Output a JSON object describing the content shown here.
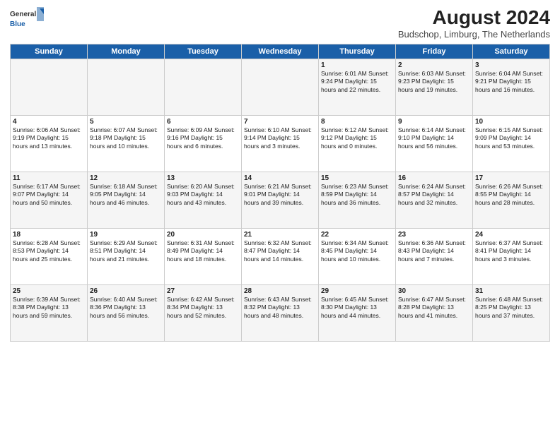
{
  "header": {
    "logo_general": "General",
    "logo_blue": "Blue",
    "main_title": "August 2024",
    "subtitle": "Budschop, Limburg, The Netherlands"
  },
  "days_of_week": [
    "Sunday",
    "Monday",
    "Tuesday",
    "Wednesday",
    "Thursday",
    "Friday",
    "Saturday"
  ],
  "weeks": [
    [
      {
        "day": "",
        "content": ""
      },
      {
        "day": "",
        "content": ""
      },
      {
        "day": "",
        "content": ""
      },
      {
        "day": "",
        "content": ""
      },
      {
        "day": "1",
        "content": "Sunrise: 6:01 AM\nSunset: 9:24 PM\nDaylight: 15 hours and 22 minutes."
      },
      {
        "day": "2",
        "content": "Sunrise: 6:03 AM\nSunset: 9:23 PM\nDaylight: 15 hours and 19 minutes."
      },
      {
        "day": "3",
        "content": "Sunrise: 6:04 AM\nSunset: 9:21 PM\nDaylight: 15 hours and 16 minutes."
      }
    ],
    [
      {
        "day": "4",
        "content": "Sunrise: 6:06 AM\nSunset: 9:19 PM\nDaylight: 15 hours and 13 minutes."
      },
      {
        "day": "5",
        "content": "Sunrise: 6:07 AM\nSunset: 9:18 PM\nDaylight: 15 hours and 10 minutes."
      },
      {
        "day": "6",
        "content": "Sunrise: 6:09 AM\nSunset: 9:16 PM\nDaylight: 15 hours and 6 minutes."
      },
      {
        "day": "7",
        "content": "Sunrise: 6:10 AM\nSunset: 9:14 PM\nDaylight: 15 hours and 3 minutes."
      },
      {
        "day": "8",
        "content": "Sunrise: 6:12 AM\nSunset: 9:12 PM\nDaylight: 15 hours and 0 minutes."
      },
      {
        "day": "9",
        "content": "Sunrise: 6:14 AM\nSunset: 9:10 PM\nDaylight: 14 hours and 56 minutes."
      },
      {
        "day": "10",
        "content": "Sunrise: 6:15 AM\nSunset: 9:09 PM\nDaylight: 14 hours and 53 minutes."
      }
    ],
    [
      {
        "day": "11",
        "content": "Sunrise: 6:17 AM\nSunset: 9:07 PM\nDaylight: 14 hours and 50 minutes."
      },
      {
        "day": "12",
        "content": "Sunrise: 6:18 AM\nSunset: 9:05 PM\nDaylight: 14 hours and 46 minutes."
      },
      {
        "day": "13",
        "content": "Sunrise: 6:20 AM\nSunset: 9:03 PM\nDaylight: 14 hours and 43 minutes."
      },
      {
        "day": "14",
        "content": "Sunrise: 6:21 AM\nSunset: 9:01 PM\nDaylight: 14 hours and 39 minutes."
      },
      {
        "day": "15",
        "content": "Sunrise: 6:23 AM\nSunset: 8:59 PM\nDaylight: 14 hours and 36 minutes."
      },
      {
        "day": "16",
        "content": "Sunrise: 6:24 AM\nSunset: 8:57 PM\nDaylight: 14 hours and 32 minutes."
      },
      {
        "day": "17",
        "content": "Sunrise: 6:26 AM\nSunset: 8:55 PM\nDaylight: 14 hours and 28 minutes."
      }
    ],
    [
      {
        "day": "18",
        "content": "Sunrise: 6:28 AM\nSunset: 8:53 PM\nDaylight: 14 hours and 25 minutes."
      },
      {
        "day": "19",
        "content": "Sunrise: 6:29 AM\nSunset: 8:51 PM\nDaylight: 14 hours and 21 minutes."
      },
      {
        "day": "20",
        "content": "Sunrise: 6:31 AM\nSunset: 8:49 PM\nDaylight: 14 hours and 18 minutes."
      },
      {
        "day": "21",
        "content": "Sunrise: 6:32 AM\nSunset: 8:47 PM\nDaylight: 14 hours and 14 minutes."
      },
      {
        "day": "22",
        "content": "Sunrise: 6:34 AM\nSunset: 8:45 PM\nDaylight: 14 hours and 10 minutes."
      },
      {
        "day": "23",
        "content": "Sunrise: 6:36 AM\nSunset: 8:43 PM\nDaylight: 14 hours and 7 minutes."
      },
      {
        "day": "24",
        "content": "Sunrise: 6:37 AM\nSunset: 8:41 PM\nDaylight: 14 hours and 3 minutes."
      }
    ],
    [
      {
        "day": "25",
        "content": "Sunrise: 6:39 AM\nSunset: 8:38 PM\nDaylight: 13 hours and 59 minutes."
      },
      {
        "day": "26",
        "content": "Sunrise: 6:40 AM\nSunset: 8:36 PM\nDaylight: 13 hours and 56 minutes."
      },
      {
        "day": "27",
        "content": "Sunrise: 6:42 AM\nSunset: 8:34 PM\nDaylight: 13 hours and 52 minutes."
      },
      {
        "day": "28",
        "content": "Sunrise: 6:43 AM\nSunset: 8:32 PM\nDaylight: 13 hours and 48 minutes."
      },
      {
        "day": "29",
        "content": "Sunrise: 6:45 AM\nSunset: 8:30 PM\nDaylight: 13 hours and 44 minutes."
      },
      {
        "day": "30",
        "content": "Sunrise: 6:47 AM\nSunset: 8:28 PM\nDaylight: 13 hours and 41 minutes."
      },
      {
        "day": "31",
        "content": "Sunrise: 6:48 AM\nSunset: 8:25 PM\nDaylight: 13 hours and 37 minutes."
      }
    ]
  ]
}
